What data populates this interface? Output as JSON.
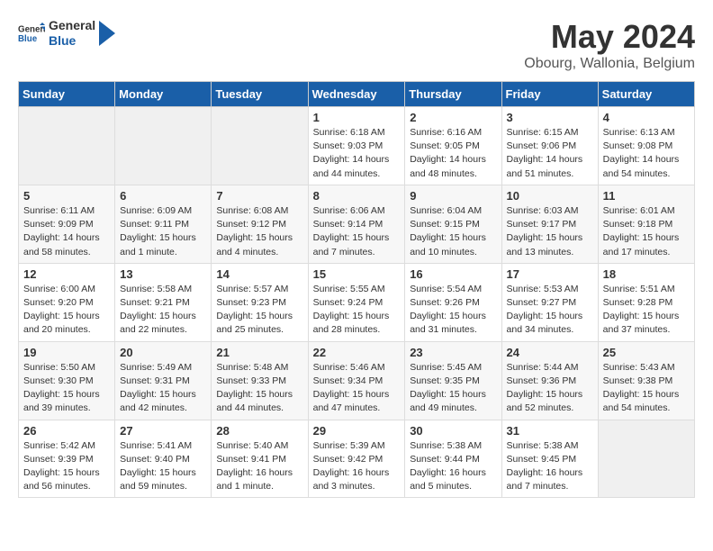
{
  "header": {
    "logo_general": "General",
    "logo_blue": "Blue",
    "month_year": "May 2024",
    "location": "Obourg, Wallonia, Belgium"
  },
  "days_of_week": [
    "Sunday",
    "Monday",
    "Tuesday",
    "Wednesday",
    "Thursday",
    "Friday",
    "Saturday"
  ],
  "weeks": [
    [
      {
        "day": "",
        "info": ""
      },
      {
        "day": "",
        "info": ""
      },
      {
        "day": "",
        "info": ""
      },
      {
        "day": "1",
        "info": "Sunrise: 6:18 AM\nSunset: 9:03 PM\nDaylight: 14 hours\nand 44 minutes."
      },
      {
        "day": "2",
        "info": "Sunrise: 6:16 AM\nSunset: 9:05 PM\nDaylight: 14 hours\nand 48 minutes."
      },
      {
        "day": "3",
        "info": "Sunrise: 6:15 AM\nSunset: 9:06 PM\nDaylight: 14 hours\nand 51 minutes."
      },
      {
        "day": "4",
        "info": "Sunrise: 6:13 AM\nSunset: 9:08 PM\nDaylight: 14 hours\nand 54 minutes."
      }
    ],
    [
      {
        "day": "5",
        "info": "Sunrise: 6:11 AM\nSunset: 9:09 PM\nDaylight: 14 hours\nand 58 minutes."
      },
      {
        "day": "6",
        "info": "Sunrise: 6:09 AM\nSunset: 9:11 PM\nDaylight: 15 hours\nand 1 minute."
      },
      {
        "day": "7",
        "info": "Sunrise: 6:08 AM\nSunset: 9:12 PM\nDaylight: 15 hours\nand 4 minutes."
      },
      {
        "day": "8",
        "info": "Sunrise: 6:06 AM\nSunset: 9:14 PM\nDaylight: 15 hours\nand 7 minutes."
      },
      {
        "day": "9",
        "info": "Sunrise: 6:04 AM\nSunset: 9:15 PM\nDaylight: 15 hours\nand 10 minutes."
      },
      {
        "day": "10",
        "info": "Sunrise: 6:03 AM\nSunset: 9:17 PM\nDaylight: 15 hours\nand 13 minutes."
      },
      {
        "day": "11",
        "info": "Sunrise: 6:01 AM\nSunset: 9:18 PM\nDaylight: 15 hours\nand 17 minutes."
      }
    ],
    [
      {
        "day": "12",
        "info": "Sunrise: 6:00 AM\nSunset: 9:20 PM\nDaylight: 15 hours\nand 20 minutes."
      },
      {
        "day": "13",
        "info": "Sunrise: 5:58 AM\nSunset: 9:21 PM\nDaylight: 15 hours\nand 22 minutes."
      },
      {
        "day": "14",
        "info": "Sunrise: 5:57 AM\nSunset: 9:23 PM\nDaylight: 15 hours\nand 25 minutes."
      },
      {
        "day": "15",
        "info": "Sunrise: 5:55 AM\nSunset: 9:24 PM\nDaylight: 15 hours\nand 28 minutes."
      },
      {
        "day": "16",
        "info": "Sunrise: 5:54 AM\nSunset: 9:26 PM\nDaylight: 15 hours\nand 31 minutes."
      },
      {
        "day": "17",
        "info": "Sunrise: 5:53 AM\nSunset: 9:27 PM\nDaylight: 15 hours\nand 34 minutes."
      },
      {
        "day": "18",
        "info": "Sunrise: 5:51 AM\nSunset: 9:28 PM\nDaylight: 15 hours\nand 37 minutes."
      }
    ],
    [
      {
        "day": "19",
        "info": "Sunrise: 5:50 AM\nSunset: 9:30 PM\nDaylight: 15 hours\nand 39 minutes."
      },
      {
        "day": "20",
        "info": "Sunrise: 5:49 AM\nSunset: 9:31 PM\nDaylight: 15 hours\nand 42 minutes."
      },
      {
        "day": "21",
        "info": "Sunrise: 5:48 AM\nSunset: 9:33 PM\nDaylight: 15 hours\nand 44 minutes."
      },
      {
        "day": "22",
        "info": "Sunrise: 5:46 AM\nSunset: 9:34 PM\nDaylight: 15 hours\nand 47 minutes."
      },
      {
        "day": "23",
        "info": "Sunrise: 5:45 AM\nSunset: 9:35 PM\nDaylight: 15 hours\nand 49 minutes."
      },
      {
        "day": "24",
        "info": "Sunrise: 5:44 AM\nSunset: 9:36 PM\nDaylight: 15 hours\nand 52 minutes."
      },
      {
        "day": "25",
        "info": "Sunrise: 5:43 AM\nSunset: 9:38 PM\nDaylight: 15 hours\nand 54 minutes."
      }
    ],
    [
      {
        "day": "26",
        "info": "Sunrise: 5:42 AM\nSunset: 9:39 PM\nDaylight: 15 hours\nand 56 minutes."
      },
      {
        "day": "27",
        "info": "Sunrise: 5:41 AM\nSunset: 9:40 PM\nDaylight: 15 hours\nand 59 minutes."
      },
      {
        "day": "28",
        "info": "Sunrise: 5:40 AM\nSunset: 9:41 PM\nDaylight: 16 hours\nand 1 minute."
      },
      {
        "day": "29",
        "info": "Sunrise: 5:39 AM\nSunset: 9:42 PM\nDaylight: 16 hours\nand 3 minutes."
      },
      {
        "day": "30",
        "info": "Sunrise: 5:38 AM\nSunset: 9:44 PM\nDaylight: 16 hours\nand 5 minutes."
      },
      {
        "day": "31",
        "info": "Sunrise: 5:38 AM\nSunset: 9:45 PM\nDaylight: 16 hours\nand 7 minutes."
      },
      {
        "day": "",
        "info": ""
      }
    ]
  ]
}
